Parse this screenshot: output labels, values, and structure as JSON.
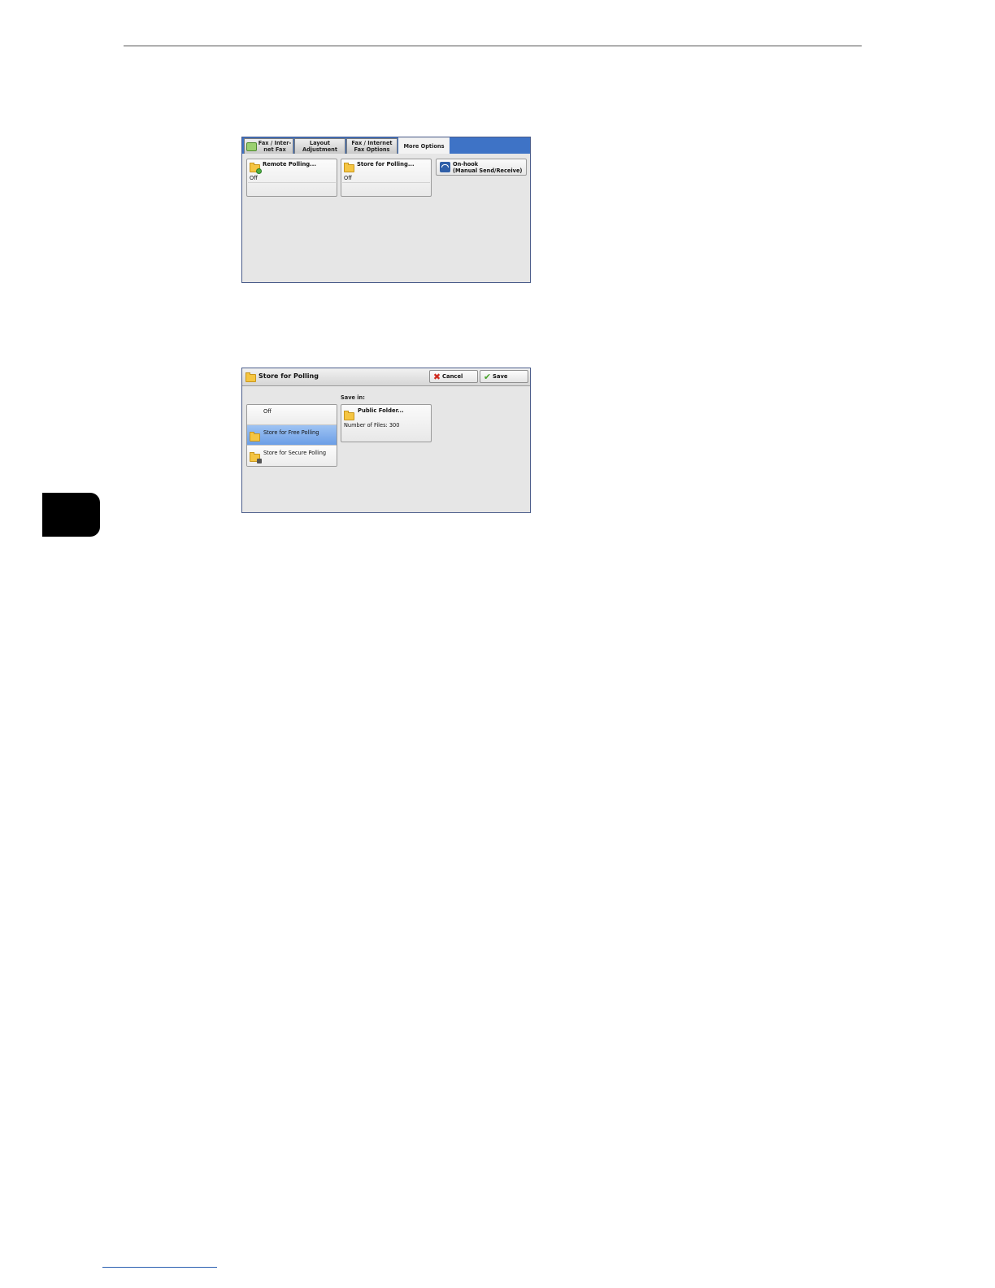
{
  "screen1": {
    "tabs": [
      {
        "label": "Fax / Inter-\nnet Fax"
      },
      {
        "label": "Layout\nAdjustment"
      },
      {
        "label": "Fax / Internet\nFax Options"
      },
      {
        "label": "More Options"
      }
    ],
    "remote_polling": {
      "label": "Remote Polling...",
      "value": "Off"
    },
    "store_for_polling": {
      "label": "Store for Polling...",
      "value": "Off"
    },
    "on_hook": {
      "label": "On-hook\n(Manual Send/Receive)"
    }
  },
  "screen2": {
    "title": "Store for Polling",
    "cancel_label": "Cancel",
    "save_label": "Save",
    "options": [
      {
        "label": "Off"
      },
      {
        "label": "Store for Free Polling"
      },
      {
        "label": "Store for Secure Polling"
      }
    ],
    "save_in_label": "Save in:",
    "folder": {
      "label": "Public Folder...",
      "count": "Number of Files: 300"
    }
  },
  "colors": {
    "tab_bar_blue": "#3e73c6",
    "selected_option": "#7aa9ea",
    "chapter_tab": "#000000"
  }
}
